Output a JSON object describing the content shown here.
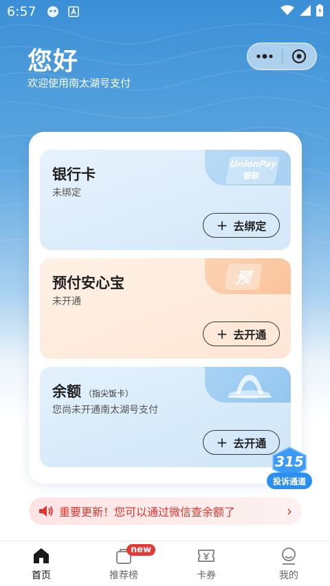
{
  "status_bar": {
    "time": "6:57",
    "icons": [
      "notification-icon",
      "app-a-icon",
      "wifi-icon",
      "signal-icon",
      "battery-icon"
    ]
  },
  "header": {
    "greeting": "您好",
    "subtitle": "欢迎使用南太湖号支付"
  },
  "capsule": {
    "icons": [
      "more-icon",
      "close-target-icon"
    ]
  },
  "cards": [
    {
      "title": "银行卡",
      "status": "未绑定",
      "action_label": "去绑定",
      "logo_text": "UnionPay",
      "logo_cn": "银联"
    },
    {
      "title": "预付安心宝",
      "status": "未开通",
      "action_label": "去开通",
      "logo_text": "预"
    },
    {
      "title": "余额",
      "title_note": "（指尖饭卡）",
      "status": "您尚未开通南太湖号支付",
      "action_label": "去开通"
    }
  ],
  "badge_315": {
    "number": "315",
    "label": "投诉通道"
  },
  "notice": {
    "text": "重要更新！您可以通过微信查余额了",
    "color": "#e0352c"
  },
  "tabbar": {
    "items": [
      {
        "label": "首页",
        "icon": "home-icon",
        "active": true
      },
      {
        "label": "推荐榜",
        "icon": "recommend-icon",
        "badge": "new"
      },
      {
        "label": "卡券",
        "icon": "coupon-icon"
      },
      {
        "label": "我的",
        "icon": "profile-icon"
      }
    ]
  },
  "colors": {
    "accent_blue": "#2c8ff0",
    "alert_red": "#e0352c"
  }
}
